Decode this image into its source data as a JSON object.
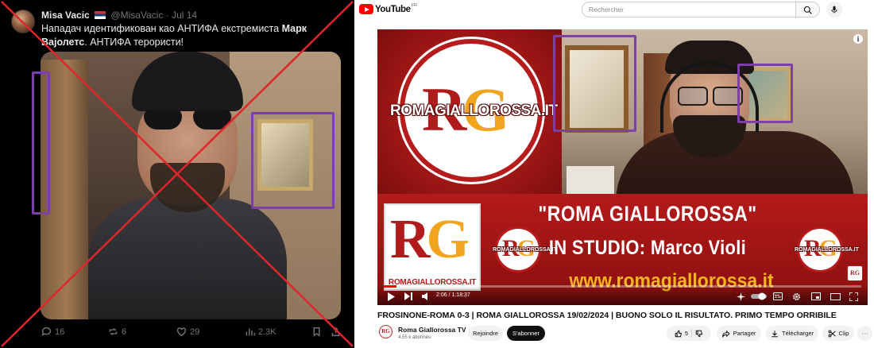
{
  "tweet": {
    "author_name": "Misa Vacic",
    "author_handle": "@MisaVacic",
    "dot": "·",
    "date": "Jul 14",
    "text_part1": "Нападач идентификован као АНТИФА екстремиста ",
    "text_bold": "Марк Вајолетс",
    "text_part2": ". АНТИФА терористи!",
    "replies": "16",
    "reposts": "6",
    "likes": "29",
    "views": "2.3K",
    "marker_color": "#7d3fa8",
    "cross_color": "#e0262a"
  },
  "youtube": {
    "logo_text": "YouTube",
    "region": "FR",
    "search_placeholder": "Rechercher",
    "player": {
      "logo_word": "ROMAGIALLOROSSA.IT",
      "rg_r": "R",
      "rg_g": "G",
      "square_site": "ROMAGIALLOROSSA.IT",
      "badge_word": "ROMAGIALLOROSSA.IT",
      "line1": "\"ROMA GIALLOROSSA\"",
      "line2": "IN STUDIO: Marco Violi",
      "line3": "www.romagiallorossa.it",
      "watermark": "RG",
      "info_icon": "i",
      "time": "2:06 / 1:18:37",
      "progress": 0.027
    },
    "video_title": "FROSINONE-ROMA 0-3 | ROMA GIALLOROSSA 19/02/2024 | BUONO SOLO IL RISULTATO. PRIMO TEMPO ORRIBILE",
    "channel": {
      "avatar": "RG",
      "name": "Roma Giallorossa TV",
      "subscribers": "4,55 k abonnés",
      "join_label": "Rejoindre",
      "subscribe_label": "S'abonner"
    },
    "actions": {
      "likes": "5",
      "share_label": "Partager",
      "download_label": "Télécharger",
      "clip_label": "Clip",
      "more_label": "···"
    },
    "colors": {
      "brand_red": "#ff0000",
      "rg_red": "#b01c1c",
      "rg_gold": "#f1a51e"
    }
  }
}
